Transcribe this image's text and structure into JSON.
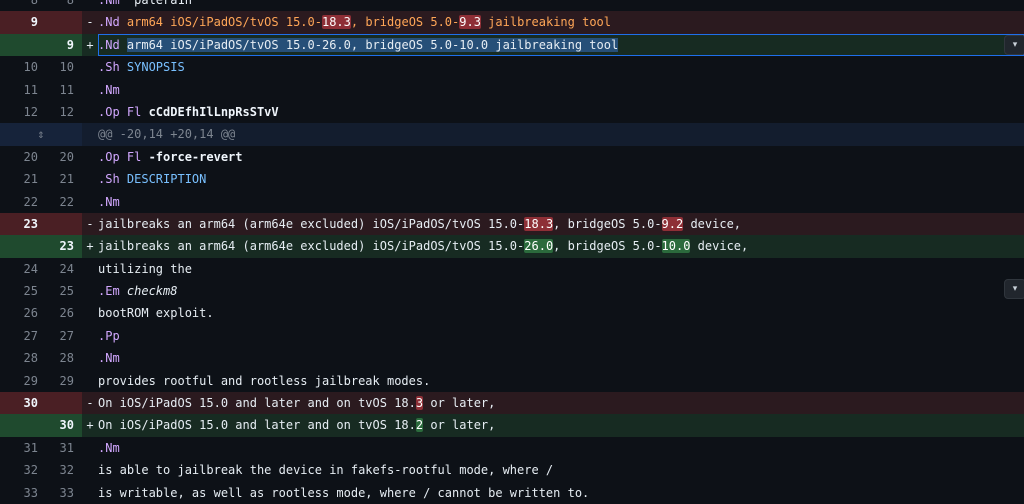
{
  "diff": {
    "hunk_header": "@@ -20,14 +20,14 @@",
    "expand_icon": "expand-icon",
    "rows": [
      {
        "type": "ctx",
        "old": "8",
        "new": "8",
        "sign": "",
        "segs": [
          [
            "mac",
            ".Nm"
          ],
          [
            "",
            "  palera1n"
          ]
        ]
      },
      {
        "type": "del",
        "old": "9",
        "new": "",
        "sign": "-",
        "segs": [
          [
            "mac",
            ".Nd"
          ],
          [
            "str",
            " arm64 iOS/iPadOS/tvOS 15.0-"
          ],
          [
            "hl-del",
            "18.3"
          ],
          [
            "str",
            ", bridgeOS 5.0-"
          ],
          [
            "hl-del",
            "9.3"
          ],
          [
            "str",
            " jailbreaking tool"
          ]
        ]
      },
      {
        "type": "add",
        "old": "",
        "new": "9",
        "sign": "+",
        "focus": true,
        "segs": [
          [
            "mac",
            ".Nd "
          ],
          [
            "sel",
            "arm64 iOS/iPadOS/tvOS 15.0-26.0, bridgeOS 5.0-10.0 jailbreaking tool"
          ]
        ]
      },
      {
        "type": "ctx",
        "old": "10",
        "new": "10",
        "sign": "",
        "segs": [
          [
            "mac",
            ".Sh "
          ],
          [
            "sec",
            "SYNOPSIS"
          ]
        ]
      },
      {
        "type": "ctx",
        "old": "11",
        "new": "11",
        "sign": "",
        "segs": [
          [
            "mac",
            ".Nm"
          ]
        ]
      },
      {
        "type": "ctx",
        "old": "12",
        "new": "12",
        "sign": "",
        "segs": [
          [
            "mac",
            ".Op Fl "
          ],
          [
            "bold",
            "cCdDEfhIlLnpRsSTvV"
          ]
        ]
      },
      {
        "type": "hunk"
      },
      {
        "type": "ctx",
        "old": "20",
        "new": "20",
        "sign": "",
        "segs": [
          [
            "mac",
            ".Op Fl "
          ],
          [
            "bold",
            "-force-revert"
          ]
        ]
      },
      {
        "type": "ctx",
        "old": "21",
        "new": "21",
        "sign": "",
        "segs": [
          [
            "mac",
            ".Sh "
          ],
          [
            "sec",
            "DESCRIPTION"
          ]
        ]
      },
      {
        "type": "ctx",
        "old": "22",
        "new": "22",
        "sign": "",
        "segs": [
          [
            "mac",
            ".Nm"
          ]
        ]
      },
      {
        "type": "del",
        "old": "23",
        "new": "",
        "sign": "-",
        "segs": [
          [
            "",
            "jailbreaks an arm64 (arm64e excluded) iOS/iPadOS/tvOS 15.0-"
          ],
          [
            "hl-del",
            "18.3"
          ],
          [
            "",
            ", bridgeOS 5.0-"
          ],
          [
            "hl-del",
            "9.2"
          ],
          [
            "",
            " device,"
          ]
        ]
      },
      {
        "type": "add",
        "old": "",
        "new": "23",
        "sign": "+",
        "segs": [
          [
            "",
            "jailbreaks an arm64 (arm64e excluded) iOS/iPadOS/tvOS 15.0-"
          ],
          [
            "hl-add",
            "26.0"
          ],
          [
            "",
            ", bridgeOS 5.0-"
          ],
          [
            "hl-add",
            "10.0"
          ],
          [
            "",
            " device,"
          ]
        ]
      },
      {
        "type": "ctx",
        "old": "24",
        "new": "24",
        "sign": "",
        "segs": [
          [
            "",
            "utilizing the"
          ]
        ]
      },
      {
        "type": "ctx",
        "old": "25",
        "new": "25",
        "sign": "",
        "segs": [
          [
            "mac",
            ".Em "
          ],
          [
            "it",
            "checkm8"
          ]
        ]
      },
      {
        "type": "ctx",
        "old": "26",
        "new": "26",
        "sign": "",
        "segs": [
          [
            "",
            "bootROM exploit."
          ]
        ]
      },
      {
        "type": "ctx",
        "old": "27",
        "new": "27",
        "sign": "",
        "segs": [
          [
            "mac",
            ".Pp"
          ]
        ]
      },
      {
        "type": "ctx",
        "old": "28",
        "new": "28",
        "sign": "",
        "segs": [
          [
            "mac",
            ".Nm"
          ]
        ]
      },
      {
        "type": "ctx",
        "old": "29",
        "new": "29",
        "sign": "",
        "segs": [
          [
            "",
            "provides rootful and rootless jailbreak modes."
          ]
        ]
      },
      {
        "type": "del",
        "old": "30",
        "new": "",
        "sign": "-",
        "segs": [
          [
            "",
            "On iOS/iPadOS 15.0 and later and on tvOS 18."
          ],
          [
            "hl-del",
            "3"
          ],
          [
            "",
            " or later,"
          ]
        ]
      },
      {
        "type": "add",
        "old": "",
        "new": "30",
        "sign": "+",
        "segs": [
          [
            "",
            "On iOS/iPadOS 15.0 and later and on tvOS 18."
          ],
          [
            "hl-add",
            "2"
          ],
          [
            "",
            " or later,"
          ]
        ]
      },
      {
        "type": "ctx",
        "old": "31",
        "new": "31",
        "sign": "",
        "segs": [
          [
            "mac",
            ".Nm"
          ]
        ]
      },
      {
        "type": "ctx",
        "old": "32",
        "new": "32",
        "sign": "",
        "segs": [
          [
            "",
            "is able to jailbreak the device in fakefs-rootful mode, where /"
          ]
        ]
      },
      {
        "type": "ctx",
        "old": "33",
        "new": "33",
        "sign": "",
        "segs": [
          [
            "",
            "is writable, as well as rootless mode, where / cannot be written to."
          ]
        ]
      }
    ]
  },
  "dropdown_icon": "▾"
}
